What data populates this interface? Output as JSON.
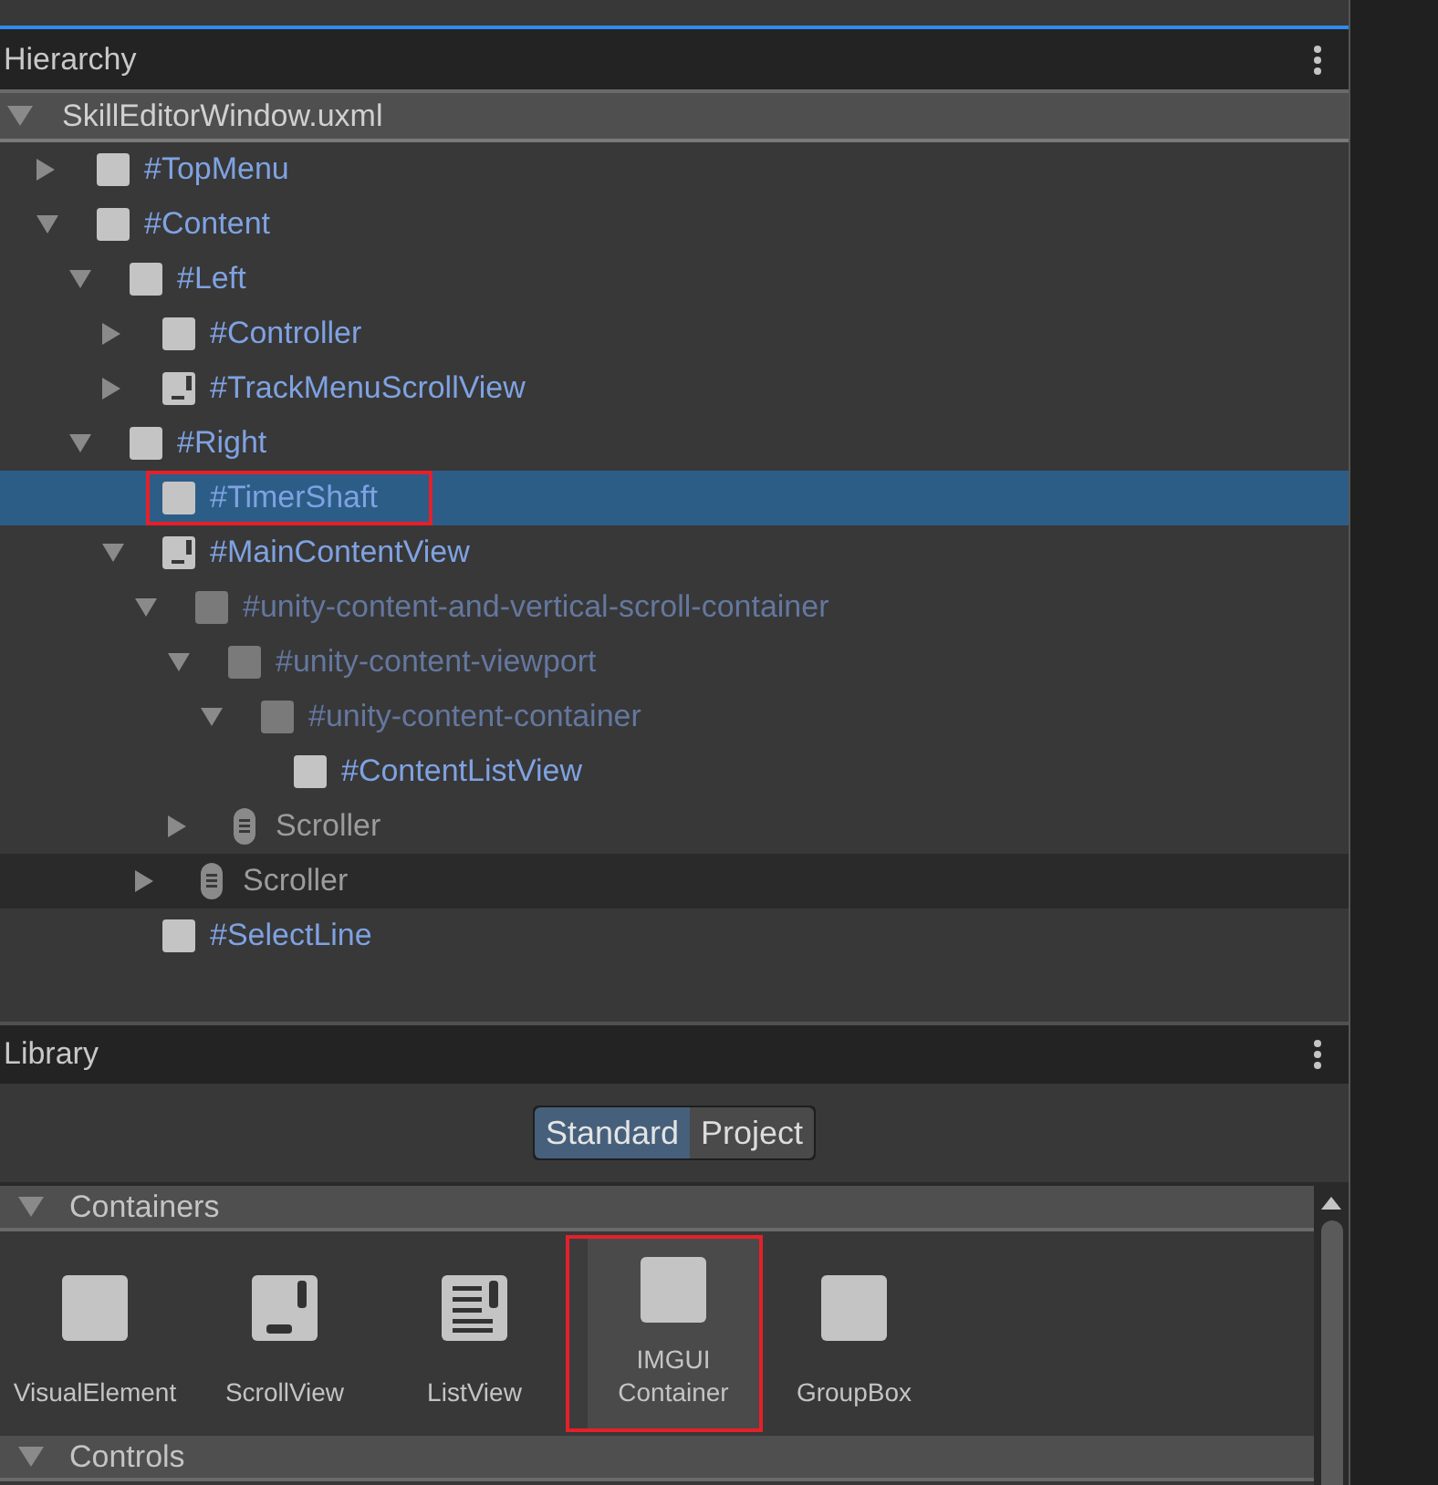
{
  "hierarchy": {
    "title": "Hierarchy",
    "root": {
      "label": "SkillEditorWindow.uxml",
      "expanded": true
    },
    "items": [
      {
        "label": "#TopMenu",
        "kind": "element",
        "expanded": false,
        "selected": false,
        "hovered": false,
        "highlighted": false
      },
      {
        "label": "#Content",
        "kind": "element",
        "expanded": true,
        "selected": false,
        "hovered": false,
        "highlighted": false,
        "children": [
          {
            "label": "#Left",
            "kind": "element",
            "expanded": true,
            "selected": false,
            "hovered": false,
            "highlighted": false,
            "children": [
              {
                "label": "#Controller",
                "kind": "element",
                "expanded": false,
                "selected": false,
                "hovered": false,
                "highlighted": false
              },
              {
                "label": "#TrackMenuScrollView",
                "kind": "scrollview",
                "expanded": false,
                "selected": false,
                "hovered": false,
                "highlighted": false
              }
            ]
          },
          {
            "label": "#Right",
            "kind": "element",
            "expanded": true,
            "selected": false,
            "hovered": false,
            "highlighted": false,
            "children": [
              {
                "label": "#TimerShaft",
                "kind": "element",
                "selected": true,
                "hovered": false,
                "highlighted": true
              },
              {
                "label": "#MainContentView",
                "kind": "scrollview",
                "expanded": true,
                "selected": false,
                "hovered": false,
                "highlighted": false,
                "children": [
                  {
                    "label": "#unity-content-and-vertical-scroll-container",
                    "kind": "template",
                    "expanded": true,
                    "selected": false,
                    "hovered": false,
                    "highlighted": false,
                    "children": [
                      {
                        "label": "#unity-content-viewport",
                        "kind": "template",
                        "expanded": true,
                        "selected": false,
                        "hovered": false,
                        "highlighted": false,
                        "children": [
                          {
                            "label": "#unity-content-container",
                            "kind": "template",
                            "expanded": true,
                            "selected": false,
                            "hovered": false,
                            "highlighted": false,
                            "children": [
                              {
                                "label": "#ContentListView",
                                "kind": "element",
                                "selected": false,
                                "hovered": false,
                                "highlighted": false
                              }
                            ]
                          }
                        ]
                      },
                      {
                        "label": "Scroller",
                        "kind": "scroller",
                        "expanded": false,
                        "selected": false,
                        "hovered": false,
                        "highlighted": false
                      }
                    ]
                  },
                  {
                    "label": "Scroller",
                    "kind": "scroller",
                    "expanded": false,
                    "selected": false,
                    "hovered": true,
                    "highlighted": false
                  }
                ]
              },
              {
                "label": "#SelectLine",
                "kind": "element",
                "selected": false,
                "hovered": false,
                "highlighted": false
              }
            ]
          }
        ]
      }
    ]
  },
  "library": {
    "title": "Library",
    "tabs": [
      {
        "label": "Standard",
        "selected": true
      },
      {
        "label": "Project",
        "selected": false
      }
    ],
    "sections": [
      {
        "title": "Containers",
        "expanded": true,
        "items": [
          {
            "label": "VisualElement",
            "kind": "element",
            "selected": false,
            "highlighted": false
          },
          {
            "label": "ScrollView",
            "kind": "scrollview",
            "selected": false,
            "highlighted": false
          },
          {
            "label": "ListView",
            "kind": "listview",
            "selected": false,
            "highlighted": false
          },
          {
            "label": "IMGUI Container",
            "kind": "element",
            "selected": true,
            "highlighted": true
          },
          {
            "label": "GroupBox",
            "kind": "element",
            "selected": false,
            "highlighted": false
          }
        ]
      },
      {
        "title": "Controls",
        "expanded": true
      }
    ]
  }
}
